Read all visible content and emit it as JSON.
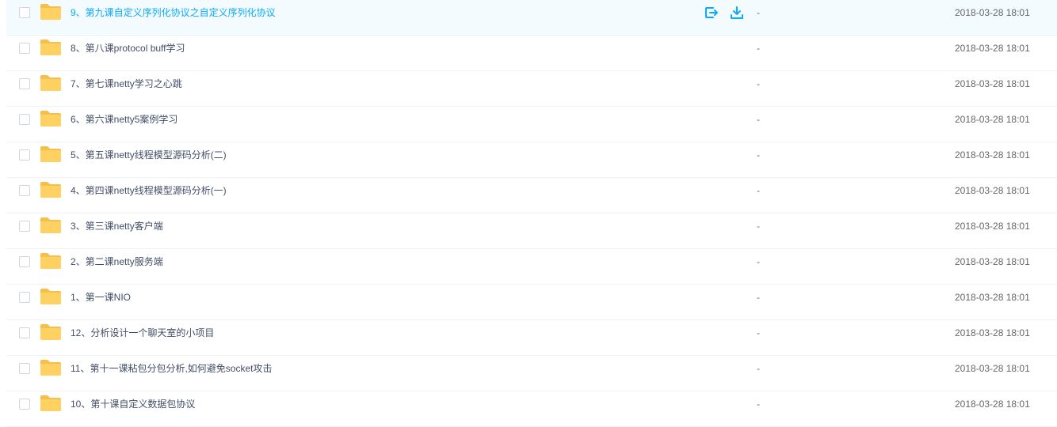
{
  "colors": {
    "folder": "#ffd062",
    "folder_dark": "#f5bf4a",
    "link": "#09aaff",
    "text": "#424e67",
    "meta": "#666666",
    "hover_bg": "#f4fbff"
  },
  "actions": {
    "share_icon": "share-icon",
    "download_icon": "download-icon"
  },
  "files": [
    {
      "name": "9、第九课自定义序列化协议之自定义序列化协议",
      "size": "-",
      "date": "2018-03-28 18:01",
      "hover": true
    },
    {
      "name": "8、第八课protocol buff学习",
      "size": "-",
      "date": "2018-03-28 18:01",
      "hover": false
    },
    {
      "name": "7、第七课netty学习之心跳",
      "size": "-",
      "date": "2018-03-28 18:01",
      "hover": false
    },
    {
      "name": "6、第六课netty5案例学习",
      "size": "-",
      "date": "2018-03-28 18:01",
      "hover": false
    },
    {
      "name": "5、第五课netty线程模型源码分析(二)",
      "size": "-",
      "date": "2018-03-28 18:01",
      "hover": false
    },
    {
      "name": "4、第四课netty线程模型源码分析(一)",
      "size": "-",
      "date": "2018-03-28 18:01",
      "hover": false
    },
    {
      "name": "3、第三课netty客户端",
      "size": "-",
      "date": "2018-03-28 18:01",
      "hover": false
    },
    {
      "name": "2、第二课netty服务端",
      "size": "-",
      "date": "2018-03-28 18:01",
      "hover": false
    },
    {
      "name": "1、第一课NIO",
      "size": "-",
      "date": "2018-03-28 18:01",
      "hover": false
    },
    {
      "name": "12、分析设计一个聊天室的小项目",
      "size": "-",
      "date": "2018-03-28 18:01",
      "hover": false
    },
    {
      "name": "11、第十一课粘包分包分析,如何避免socket攻击",
      "size": "-",
      "date": "2018-03-28 18:01",
      "hover": false
    },
    {
      "name": "10、第十课自定义数据包协议",
      "size": "-",
      "date": "2018-03-28 18:01",
      "hover": false
    }
  ]
}
